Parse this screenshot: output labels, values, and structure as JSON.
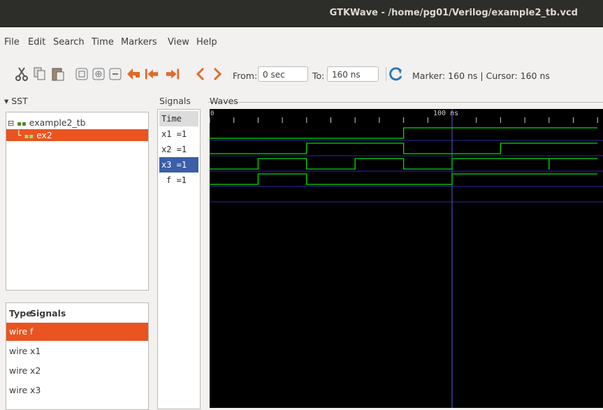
{
  "window": {
    "title": "GTKWave - /home/pg01/Verilog/example2_tb.vcd"
  },
  "menu": [
    "File",
    "Edit",
    "Search",
    "Time",
    "Markers",
    "View",
    "Help"
  ],
  "toolbar": {
    "from_label": "From:",
    "from_value": "0 sec",
    "to_label": "To:",
    "to_value": "160 ns",
    "status": "Marker: 160 ns  |  Cursor: 160 ns",
    "icons": [
      "cut-icon",
      "copy-icon",
      "paste-icon",
      "zoom-fit-icon",
      "zoom-in-icon",
      "zoom-out-icon",
      "zoom-start-icon",
      "zoom-end-icon",
      "zoom-marker-icon",
      "prev-icon",
      "next-icon",
      "reload-icon"
    ]
  },
  "sst": {
    "label": "SST",
    "tree": [
      {
        "label": "example2_tb",
        "selected": false
      },
      {
        "label": "ex2",
        "selected": true
      }
    ],
    "list_headers": {
      "type": "Type",
      "signals": "Signals"
    },
    "list": [
      {
        "type": "wire",
        "name": "f",
        "selected": true
      },
      {
        "type": "wire",
        "name": "x1",
        "selected": false
      },
      {
        "type": "wire",
        "name": "x2",
        "selected": false
      },
      {
        "type": "wire",
        "name": "x3",
        "selected": false
      }
    ]
  },
  "signals_pane": {
    "label": "Signals",
    "rows": [
      "Time",
      "x1 =1",
      "x2 =1",
      "x3 =1",
      "f =1"
    ],
    "selected_row": 3
  },
  "waves": {
    "label": "Waves",
    "start_label": "0",
    "marker_label": "100 ns",
    "time_range_ns": [
      0,
      160
    ],
    "marker_ns": 100,
    "signals": [
      {
        "name": "x1",
        "transitions": [
          [
            0,
            0
          ],
          [
            80,
            1
          ]
        ]
      },
      {
        "name": "x2",
        "transitions": [
          [
            0,
            0
          ],
          [
            40,
            1
          ],
          [
            80,
            0
          ],
          [
            120,
            1
          ]
        ]
      },
      {
        "name": "x3",
        "transitions": [
          [
            0,
            0
          ],
          [
            20,
            1
          ],
          [
            40,
            0
          ],
          [
            60,
            1
          ],
          [
            80,
            0
          ],
          [
            100,
            1
          ],
          [
            140,
            0
          ],
          [
            140.01,
            1
          ]
        ]
      },
      {
        "name": "f",
        "transitions": [
          [
            0,
            0
          ],
          [
            20,
            1
          ],
          [
            40,
            0
          ],
          [
            100,
            1
          ]
        ]
      }
    ],
    "colors": {
      "background": "#000000",
      "wave": "#00e000",
      "grid": "#2a2aa0",
      "marker": "#5a5ad0",
      "text": "#d0d0d0"
    }
  },
  "colors": {
    "accent": "#e95420",
    "selected_signal": "#3b5ea8"
  }
}
